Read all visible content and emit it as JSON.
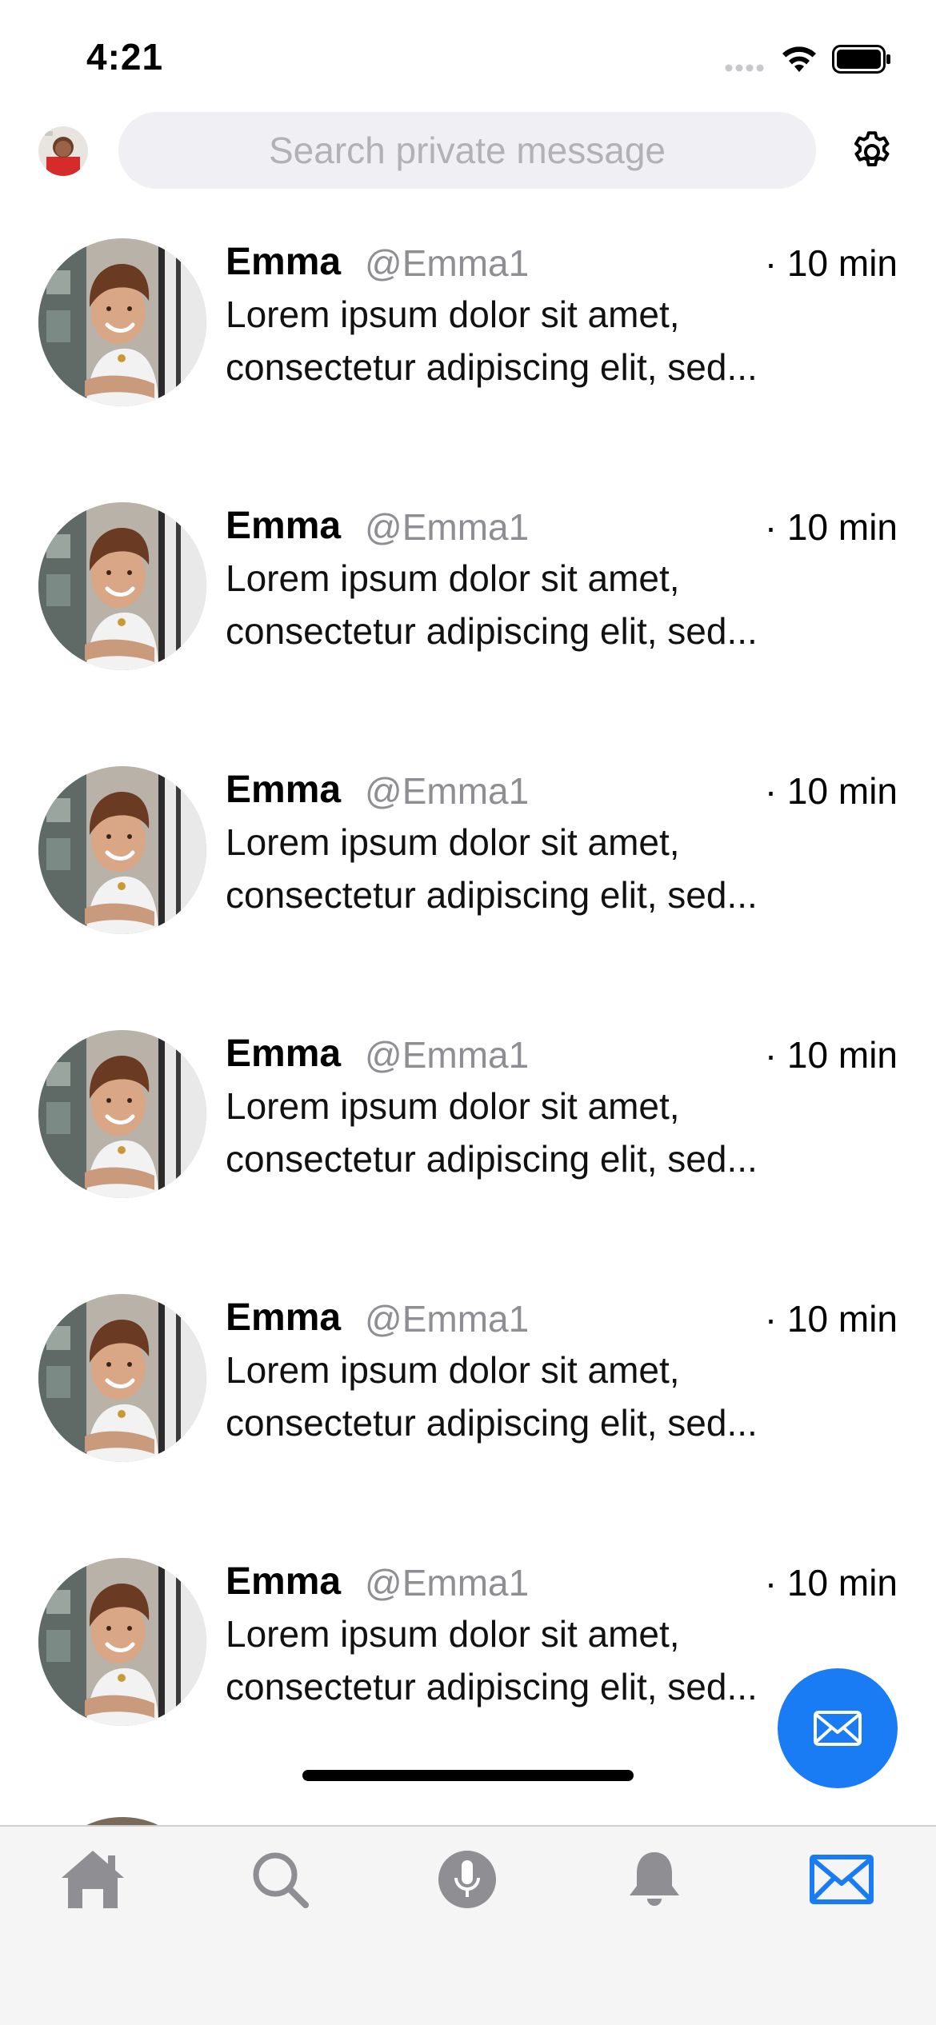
{
  "status_bar": {
    "time": "4:21",
    "icons": [
      "cellular-signal-icon",
      "wifi-icon",
      "battery-icon"
    ]
  },
  "header": {
    "search_placeholder": "Search private message",
    "settings_icon": "gear-icon"
  },
  "messages": [
    {
      "name": "Emma",
      "handle": "@Emma1",
      "time": "· 10 min",
      "preview": "Lorem ipsum dolor sit amet, consectetur adipiscing elit, sed..."
    },
    {
      "name": "Emma",
      "handle": "@Emma1",
      "time": "· 10 min",
      "preview": "Lorem ipsum dolor sit amet, consectetur adipiscing elit, sed..."
    },
    {
      "name": "Emma",
      "handle": "@Emma1",
      "time": "· 10 min",
      "preview": "Lorem ipsum dolor sit amet, consectetur adipiscing elit, sed..."
    },
    {
      "name": "Emma",
      "handle": "@Emma1",
      "time": "· 10 min",
      "preview": "Lorem ipsum dolor sit amet, consectetur adipiscing elit, sed..."
    },
    {
      "name": "Emma",
      "handle": "@Emma1",
      "time": "· 10 min",
      "preview": "Lorem ipsum dolor sit amet, consectetur adipiscing elit, sed..."
    },
    {
      "name": "Emma",
      "handle": "@Emma1",
      "time": "· 10 min",
      "preview": "Lorem ipsum dolor sit amet, consectetur adipiscing elit, sed..."
    }
  ],
  "fab": {
    "icon": "envelope-icon",
    "color": "#1a7cf5"
  },
  "tabbar": {
    "tabs": [
      {
        "icon": "home-icon",
        "active": false
      },
      {
        "icon": "search-icon",
        "active": false
      },
      {
        "icon": "microphone-icon",
        "active": false
      },
      {
        "icon": "bell-icon",
        "active": false
      },
      {
        "icon": "envelope-icon",
        "active": true
      }
    ],
    "active_color": "#1a7cf5",
    "inactive_color": "#8e8e93"
  }
}
